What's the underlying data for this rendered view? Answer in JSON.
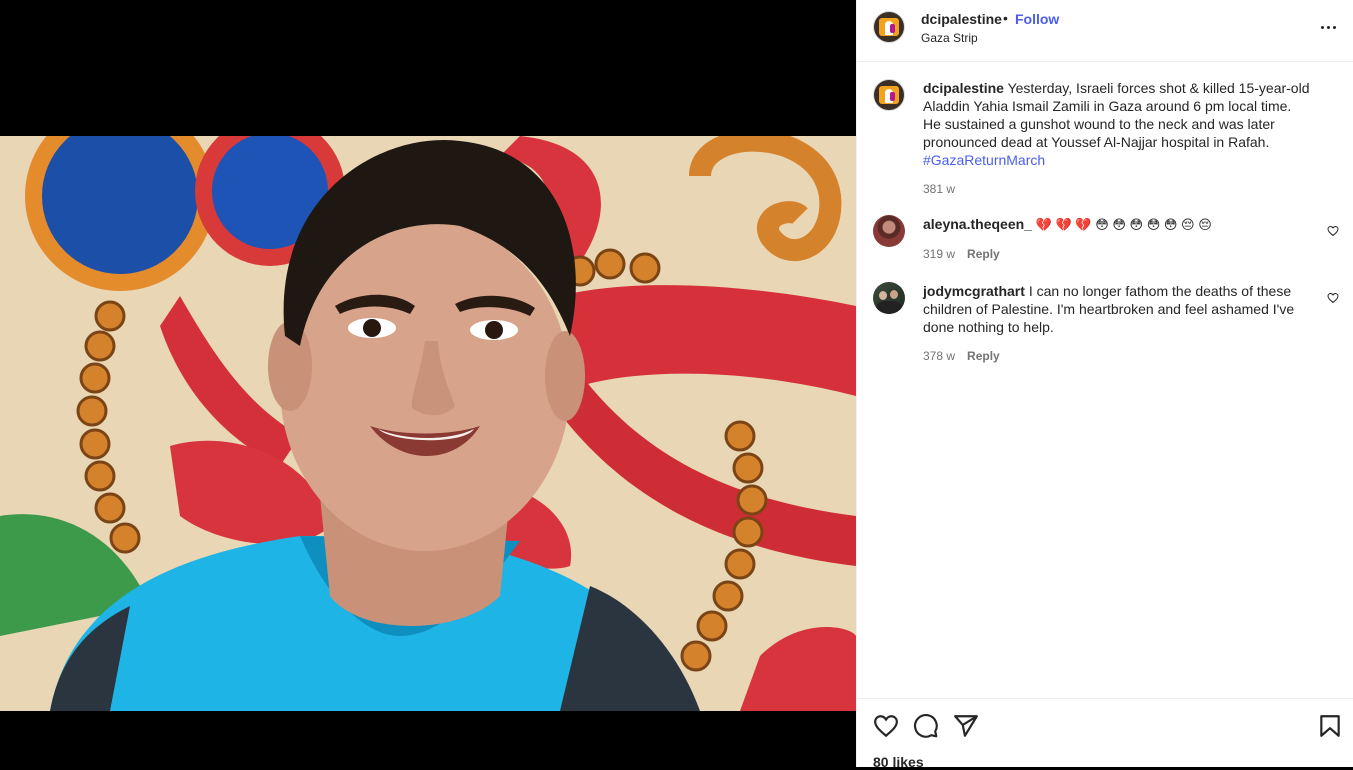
{
  "header": {
    "username": "dcipalestine",
    "separator": "•",
    "follow_label": "Follow",
    "location": "Gaza Strip"
  },
  "caption": {
    "username": "dcipalestine",
    "text": "Yesterday, Israeli forces shot & killed 15-year-old Aladdin Yahia Ismail Zamili in Gaza around 6 pm local time. He sustained a gunshot wound to the neck and was later pronounced dead at Youssef Al-Najjar hospital in Rafah.",
    "hashtag": "#GazaReturnMarch",
    "age": "381 w"
  },
  "comments": [
    {
      "username": "aleyna.theqeen_",
      "text": "💔 💔 💔 😳 😳 😳 😳 😳 😔 😔",
      "age": "319 w",
      "reply_label": "Reply"
    },
    {
      "username": "jodymcgrathart",
      "text": "I can no longer fathom the deaths of these children of Palestine. I'm heartbroken and feel ashamed I've done nothing to help.",
      "age": "378 w",
      "reply_label": "Reply"
    }
  ],
  "footer": {
    "likes": "80 likes"
  },
  "icons": {
    "like": "heart-icon",
    "comment": "comment-icon",
    "share": "send-icon",
    "save": "bookmark-icon",
    "more": "more-icon"
  },
  "colors": {
    "link": "#4a5df0",
    "text": "#262626",
    "muted": "#737373",
    "divider": "#efefef"
  }
}
